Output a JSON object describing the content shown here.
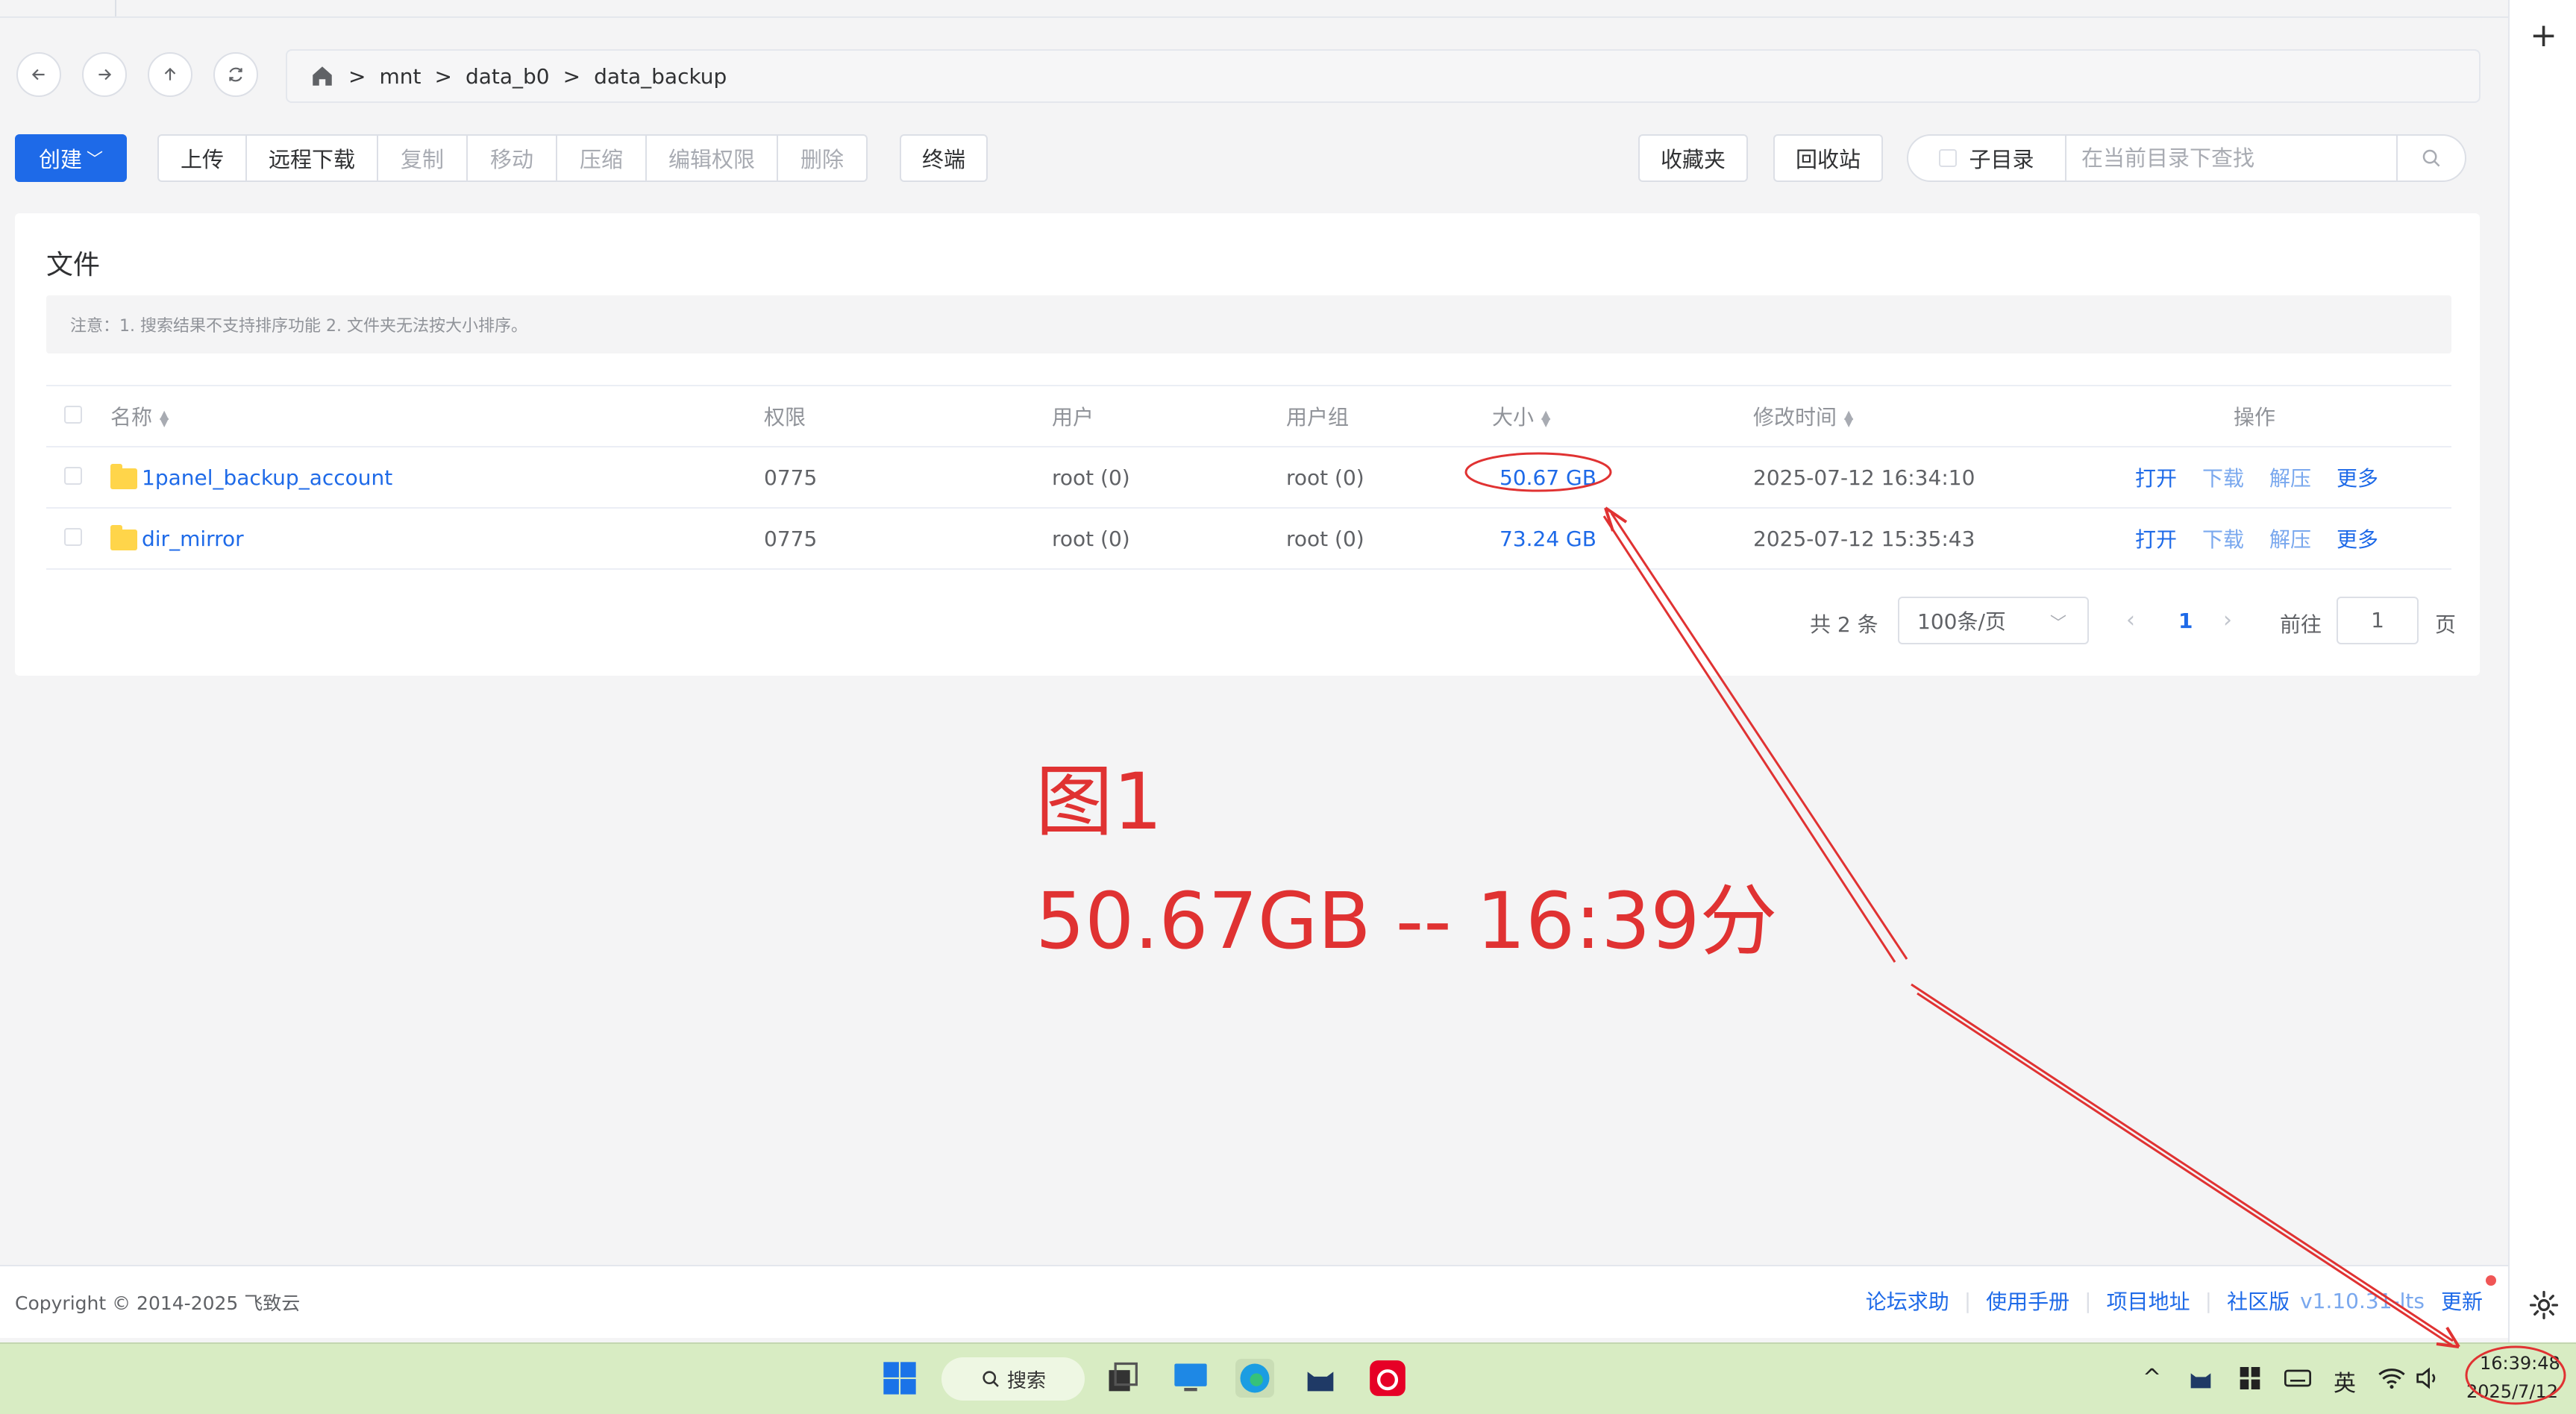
{
  "breadcrumb": {
    "home": "home-icon",
    "parts": [
      "mnt",
      "data_b0",
      "data_backup"
    ],
    "separator": ">"
  },
  "toolbar": {
    "create": "创建",
    "group": [
      "上传",
      "远程下载",
      "复制",
      "移动",
      "压缩",
      "编辑权限",
      "删除"
    ],
    "terminal": "终端",
    "favorites": "收藏夹",
    "recycle": "回收站",
    "subdir": "子目录",
    "search_placeholder": "在当前目录下查找"
  },
  "card": {
    "title": "文件",
    "notice": "注意：1. 搜索结果不支持排序功能 2. 文件夹无法按大小排序。",
    "columns": [
      "名称",
      "权限",
      "用户",
      "用户组",
      "大小",
      "修改时间",
      "操作"
    ],
    "rows": [
      {
        "name": "1panel_backup_account",
        "perm": "0775",
        "user": "root (0)",
        "group": "root (0)",
        "size": "50.67 GB",
        "mtime": "2025-07-12 16:34:10"
      },
      {
        "name": "dir_mirror",
        "perm": "0775",
        "user": "root (0)",
        "group": "root (0)",
        "size": "73.24 GB",
        "mtime": "2025-07-12 15:35:43"
      }
    ],
    "ops": [
      "打开",
      "下载",
      "解压",
      "更多"
    ]
  },
  "pager": {
    "total": "共 2 条",
    "size": "100条/页",
    "current": "1",
    "goto": "前往",
    "input": "1",
    "unit": "页"
  },
  "annotation": {
    "line1": "图1",
    "line2": "50.67GB -- 16:39分",
    "color": "#e03232"
  },
  "footer": {
    "copyright": "Copyright © 2014-2025 飞致云",
    "links": [
      "论坛求助",
      "使用手册",
      "项目地址",
      "社区版"
    ],
    "version": "v1.10.31-lts",
    "update": "更新"
  },
  "taskbar": {
    "search": "搜索",
    "ime": "英",
    "time": "16:39:48",
    "date": "2025/7/12"
  },
  "colors": {
    "primary": "#1e6ae8",
    "taskbar": "#d8ecc3"
  }
}
